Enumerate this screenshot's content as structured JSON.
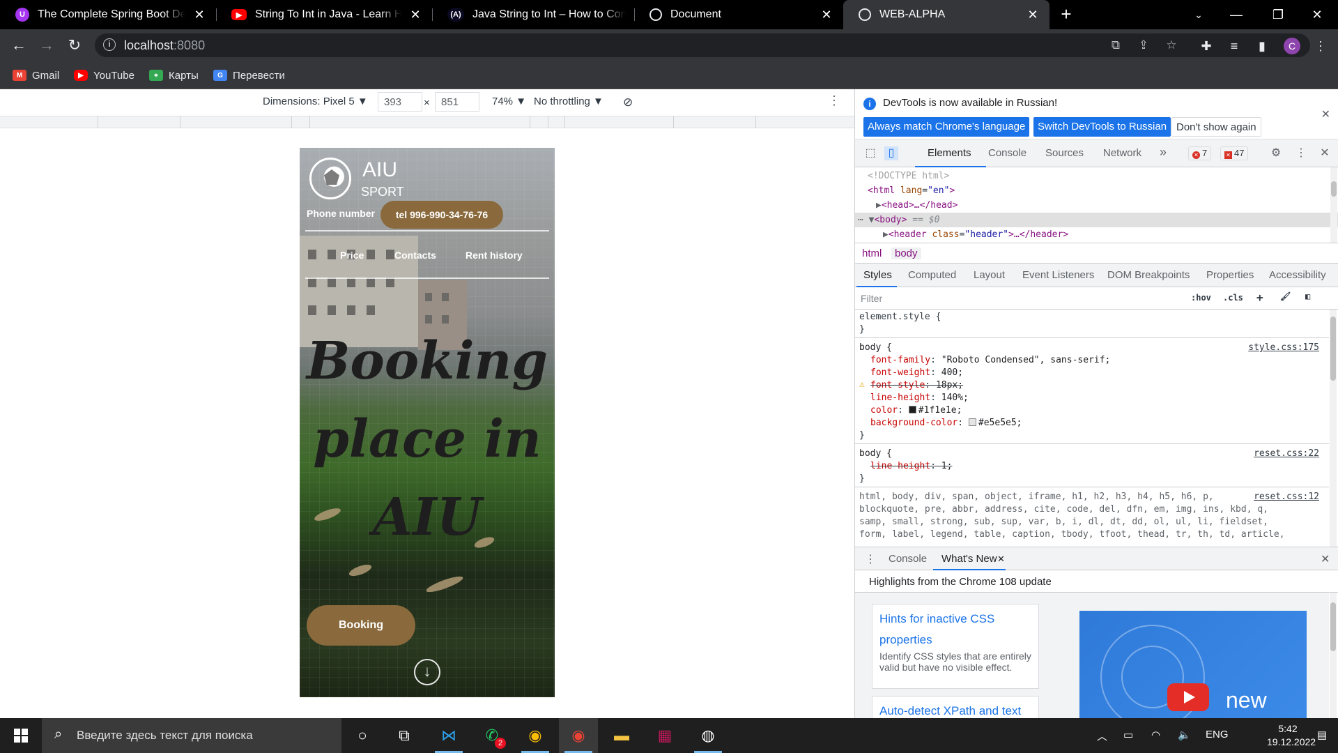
{
  "tabs": [
    {
      "title": "The Complete Spring Boot Devel",
      "icon": "udemy-icon",
      "color": "#a435f0"
    },
    {
      "title": "String To Int in Java - Learn How",
      "icon": "youtube-icon",
      "color": "#ff0000"
    },
    {
      "title": "Java String to Int – How to Conve",
      "icon": "freecodecamp-icon",
      "color": "#0a0a23"
    },
    {
      "title": "Document",
      "icon": "globe-icon",
      "color": "#e8eaed"
    },
    {
      "title": "WEB-ALPHA",
      "icon": "globe-icon",
      "color": "#e8eaed"
    }
  ],
  "toolbar": {
    "host": "localhost",
    "port": ":8080",
    "profile_initial": "C"
  },
  "bookmarks": [
    {
      "label": "Gmail",
      "icon": "gmail-icon"
    },
    {
      "label": "YouTube",
      "icon": "youtube-icon"
    },
    {
      "label": "Карты",
      "icon": "maps-icon"
    },
    {
      "label": "Перевести",
      "icon": "translate-icon"
    }
  ],
  "device_toolbar": {
    "dimensions": "Dimensions: Pixel 5 ▼",
    "width": "393",
    "times": "×",
    "height": "851",
    "zoom": "74% ▼",
    "throttling": "No throttling ▼"
  },
  "site": {
    "logo_title": "AIU",
    "logo_sub": "SPORT",
    "phone_label": "Phone number",
    "phone_button": "tel 996-990-34-76-76",
    "nav": [
      "Price",
      "Contacts",
      "Rent history"
    ],
    "hero": "Booking place in AIU",
    "booking_button": "Booking"
  },
  "devtools": {
    "info_message": "DevTools is now available in Russian!",
    "btn_match": "Always match Chrome's language",
    "btn_switch": "Switch DevTools to Russian",
    "btn_dont_show": "Don't show again",
    "tabs": [
      "Elements",
      "Console",
      "Sources",
      "Network"
    ],
    "more": "»",
    "errors": "7",
    "issues": "47",
    "dom": {
      "doctype": "<!DOCTYPE html>",
      "html_open": "<html",
      "html_attr": "lang",
      "html_val": "\"en\"",
      "head": "<head>…</head>",
      "body": "<body>",
      "body_eq": "== $0",
      "header_open": "<header",
      "header_attr": "class",
      "header_val": "\"header\"",
      "header_rest": ">…</header>"
    },
    "breadcrumbs": [
      "html",
      "body"
    ],
    "side_tabs": [
      "Styles",
      "Computed",
      "Layout",
      "Event Listeners",
      "DOM Breakpoints",
      "Properties",
      "Accessibility"
    ],
    "filter_placeholder": "Filter",
    "hov": ":hov",
    "cls": ".cls",
    "styles": {
      "element_style": "element.style {",
      "close": "}",
      "body_sel": "body {",
      "src1": "style.css:175",
      "decls1": [
        {
          "prop": "font-family",
          "val": "\"Roboto Condensed\", sans-serif;"
        },
        {
          "prop": "font-weight",
          "val": "400;"
        },
        {
          "prop": "font-style",
          "val": "18px;"
        },
        {
          "prop": "line-height",
          "val": "140%;"
        },
        {
          "prop": "color",
          "val": "#1f1e1e;"
        },
        {
          "prop": "background-color",
          "val": "#e5e5e5;"
        }
      ],
      "src2": "reset.css:22",
      "decl2_prop": "line-height",
      "decl2_val": "1;",
      "src3": "reset.css:12",
      "reset_line1": "html, body, div, span, object, iframe, h1, h2, h3, h4, h5, h6, p,",
      "reset_line2": "blockquote, pre, abbr, address, cite, code, del, dfn, em, img, ins, kbd, q,",
      "reset_line3": "samp, small, strong, sub, sup, var, b, i, dl, dt, dd, ol, ul, li, fieldset,",
      "reset_line4": "form, label, legend, table, caption, tbody, tfoot, thead, tr, th, td, article,"
    },
    "drawer_tabs": [
      "Console",
      "What's New"
    ],
    "whatsnew_heading": "Highlights from the Chrome 108 update",
    "card1_title": "Hints for inactive CSS properties",
    "card1_desc": "Identify CSS styles that are entirely valid but have no visible effect.",
    "card2_title": "Auto-detect XPath and text",
    "video_text": "new"
  },
  "taskbar": {
    "search_placeholder": "Введите здесь текст для поиска",
    "whatsapp_badge": "2",
    "lang": "ENG",
    "time": "5:42",
    "date": "19.12.2022"
  },
  "colors": {
    "accent_brown": "#8a6a3d",
    "devtools_blue": "#1a73e8",
    "swatch_color": "#1f1e1e",
    "swatch_bg": "#e5e5e5"
  }
}
